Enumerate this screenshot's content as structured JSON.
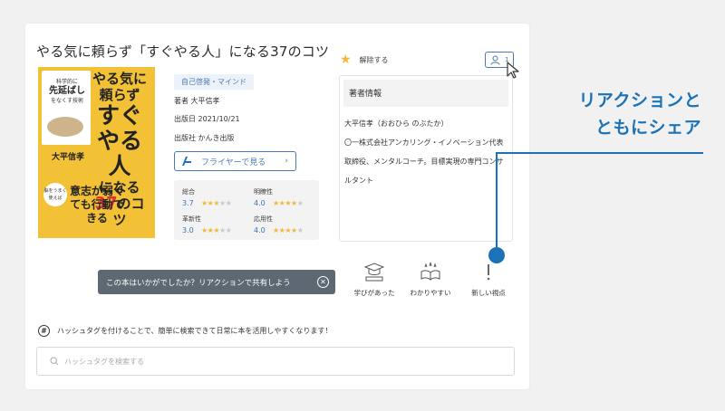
{
  "book": {
    "title": "やる気に頼らず「すぐやる人」になる37のコツ",
    "category_tag": "自己啓発・マインド",
    "author_line": "著者 大平信孝",
    "date_line": "出版日 2021/10/21",
    "publisher_line": "出版社 かんき出版",
    "flyer_button": "フライヤーで見る"
  },
  "cover": {
    "sub_small": "科学的に",
    "sub_big": "先延ばし",
    "sub_small2": "をなくす技術",
    "main_line1": "やる気に頼らず",
    "main_line2": "すぐやる人",
    "main_line3_pre": "になる",
    "main_line3_num": "37",
    "main_line3_post": "のコツ",
    "author": "大平信孝",
    "badge": "脳をうまく使えば",
    "bottom": "意志が弱くても行動できる"
  },
  "ratings": [
    {
      "label": "総合",
      "value": "3.7",
      "stars": 3.7
    },
    {
      "label": "明瞭性",
      "value": "4.0",
      "stars": 4.0
    },
    {
      "label": "革新性",
      "value": "3.0",
      "stars": 3.0
    },
    {
      "label": "応用性",
      "value": "4.0",
      "stars": 4.0
    }
  ],
  "favorite": {
    "label": "解除する",
    "icon": "star-icon"
  },
  "follow": {
    "count": "1",
    "icon": "user-icon"
  },
  "author_info": {
    "heading": "著者情報",
    "lines": [
      "大平信孝（おおひら のぶたか）",
      "〇一株式会社アンカリング・イノベーション代表",
      "取締役、メンタルコーチ。目標実現の専門コンサ",
      "ルタント"
    ]
  },
  "reaction_prompt": {
    "text": "この本はいかがでしたか？リアクションで共有しよう"
  },
  "reactions": [
    {
      "label": "学びがあった",
      "icon": "graduation-cap-icon"
    },
    {
      "label": "わかりやすい",
      "icon": "open-book-icon"
    },
    {
      "label": "新しい視点",
      "icon": "exclamation-icon"
    }
  ],
  "hashtag": {
    "info": "ハッシュタグを付けることで、簡単に検索できて日常に本を活用しやすくなります！",
    "placeholder": "ハッシュタグを検索する"
  },
  "callout": {
    "line1": "リアクションと",
    "line2": "ともにシェア"
  },
  "colors": {
    "accent_blue": "#1b72b8",
    "star_yellow": "#f2b735",
    "prompt_bg": "#5d6873",
    "rating_value": "#3e72b8"
  }
}
